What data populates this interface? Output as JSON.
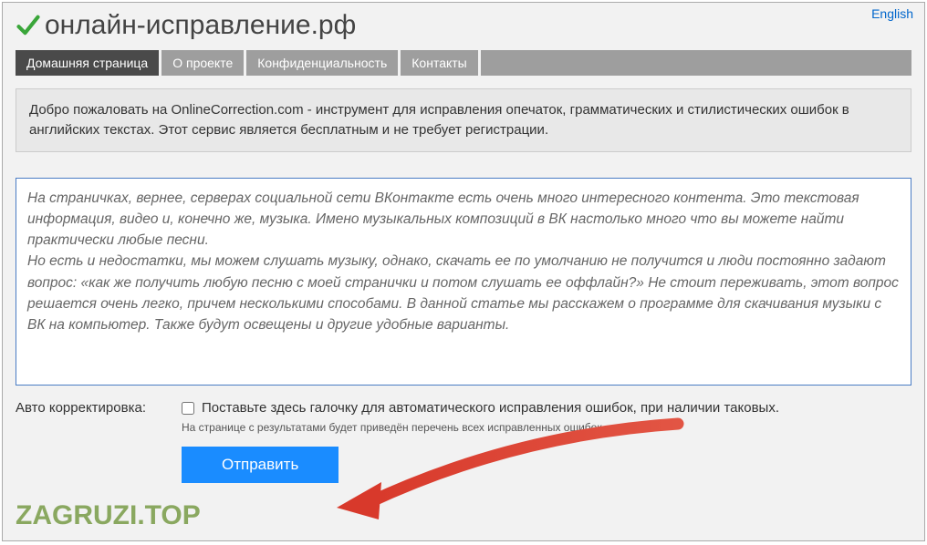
{
  "lang_link": "English",
  "site_title": "онлайн-исправление.рф",
  "nav": {
    "items": [
      {
        "label": "Домашняя страница",
        "active": true
      },
      {
        "label": "О проекте",
        "active": false
      },
      {
        "label": "Конфиденциальность",
        "active": false
      },
      {
        "label": "Контакты",
        "active": false
      }
    ]
  },
  "welcome_text": "Добро пожаловать на OnlineCorrection.com - инструмент для исправления опечаток, грамматических и стилистических ошибок в английских текстах. Этот сервис является бесплатным и не требует регистрации.",
  "textarea_value": "На страничках, вернее, серверах социальной сети ВКонтакте есть очень много интересного контента. Это текстовая информация, видео и, конечно же, музыка. Имено музыкальных композиций в ВК настолько много что вы можете найти практически любые песни.\nНо есть и недостатки, мы можем слушать музыку, однако, скачать ее по умолчанию не получится и люди постоянно задают вопрос: «как же получить любую песню с моей странички и потом слушать ее оффлайн?» Не стоит переживать, этот вопрос решается очень легко, причем несколькими способами. В данной статье мы расскажем о программе для скачивания музыки с ВК на компьютер. Также будут освещены и другие удобные варианты.",
  "autocorrect": {
    "label": "Авто корректировка:",
    "checkbox_text": "Поставьте здесь галочку для автоматического исправления ошибок, при наличии таковых.",
    "hint": "На странице с результатами будет приведён перечень всех исправленных ошибок.",
    "checked": false
  },
  "submit_label": "Отправить",
  "watermark": "ZAGRUZI.TOP",
  "colors": {
    "accent_green": "#3aa63a",
    "nav_active": "#4a4a4a",
    "nav_inactive": "#9e9e9e",
    "submit_bg": "#1a8cff",
    "arrow": "#d8392b"
  }
}
